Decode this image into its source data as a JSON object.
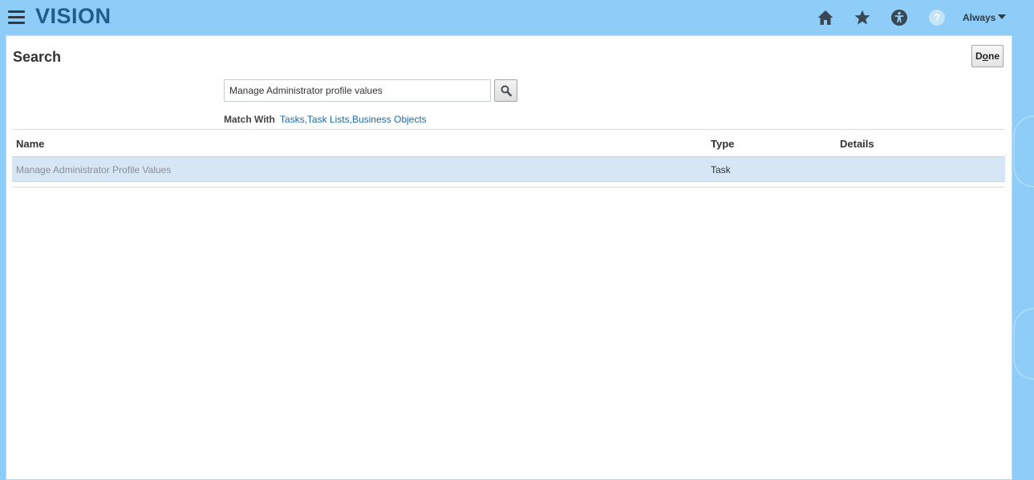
{
  "header": {
    "logo": "VISION",
    "icons": [
      "home-icon",
      "star-icon",
      "accessibility-icon",
      "help-icon"
    ],
    "user_menu": "Always"
  },
  "page": {
    "title": "Search",
    "done_label": "Done",
    "done_mnemonic": "o"
  },
  "search": {
    "value": "Manage Administrator profile values",
    "match_with_label": "Match With",
    "match_options": [
      "Tasks",
      "Task Lists",
      "Business Objects"
    ]
  },
  "table": {
    "columns": [
      "Name",
      "Type",
      "Details"
    ],
    "rows": [
      {
        "name": "Manage Administrator Profile Values",
        "type": "Task",
        "details": ""
      }
    ]
  },
  "colors": {
    "header_bg": "#8ecdf7",
    "logo": "#1f5c8f",
    "link": "#1d6aa5",
    "selected_row": "#d6e6f5"
  }
}
